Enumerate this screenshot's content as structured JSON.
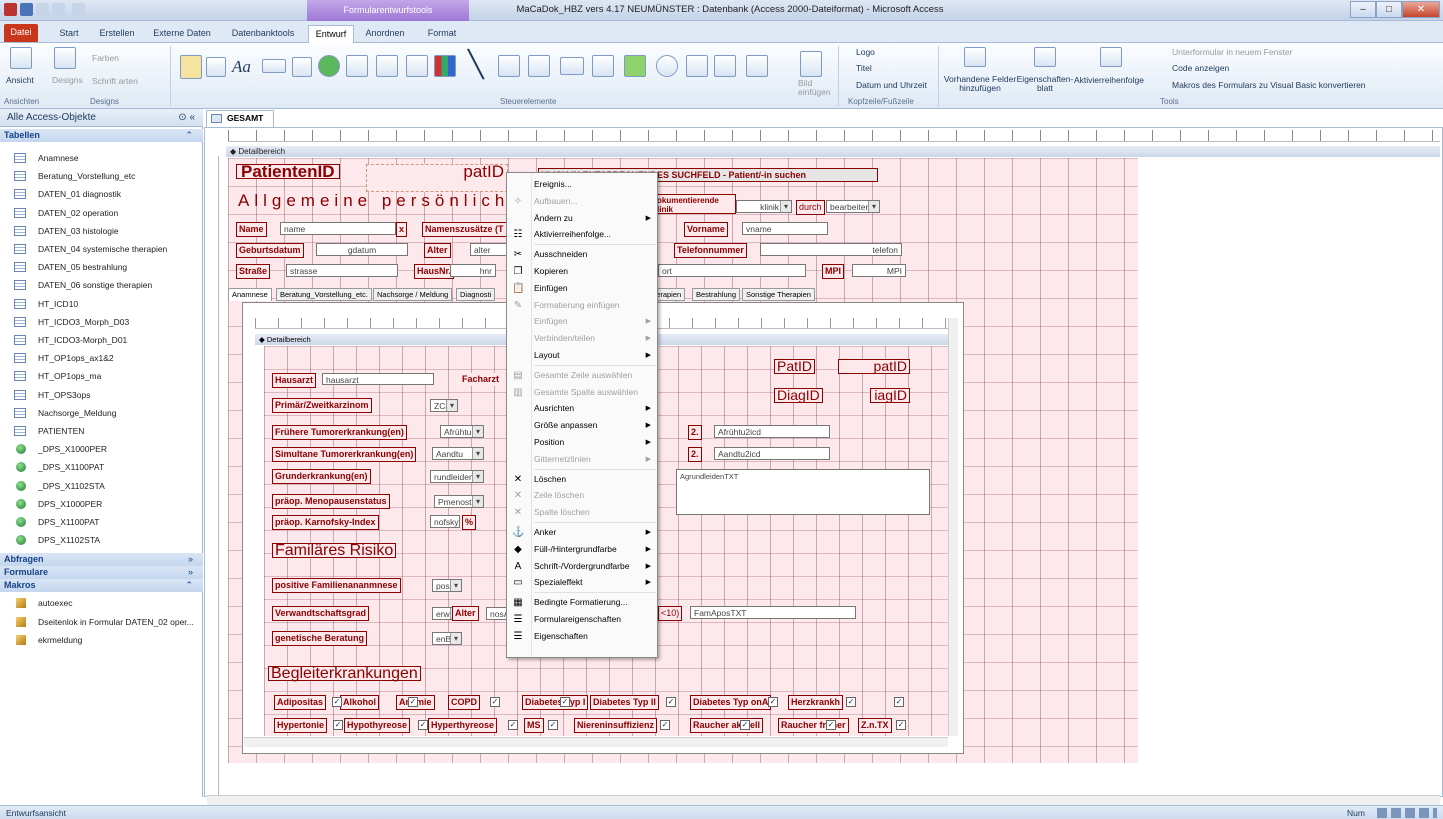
{
  "window": {
    "title": "MaCaDok_HBZ vers 4.17 NEUMÜNSTER : Datenbank (Access 2000-Dateiformat) - Microsoft Access",
    "context_tab": "Formularentwurfstools",
    "min": "–",
    "max": "□",
    "close": "✕"
  },
  "ribbon_tabs": [
    "Datei",
    "Start",
    "Erstellen",
    "Externe Daten",
    "Datenbanktools",
    "Entwurf",
    "Anordnen",
    "Format"
  ],
  "ribbon": {
    "ansicht": "Ansicht",
    "designs": "Designs",
    "farben": "Farben",
    "schriftarten": "Schrift arten",
    "bild": "Bild einfügen",
    "logo": "Logo",
    "titel": "Titel",
    "datum": "Datum und Uhrzeit",
    "vorhandene": "Vorhandene Felder hinzufügen",
    "eigenschaften": "Eigenschaften- blatt",
    "aktivierreihenfolge": "Aktivierreihenfolge",
    "unterformular": "Unterformular in neuem Fenster",
    "code": "Code anzeigen",
    "makros": "Makros des Formulars zu Visual Basic konvertieren",
    "groups": {
      "ansichten": "Ansichten",
      "designs": "Designs",
      "steuerelemente": "Steuerelemente",
      "kopfzeile": "Kopfzeile/Fußzeile",
      "tools": "Tools"
    }
  },
  "nav": {
    "header": "Alle Access-Objekte",
    "tabellen": "Tabellen",
    "tables": [
      "Anamnese",
      "Beratung_Vorstellung_etc",
      "DATEN_01 diagnostik",
      "DATEN_02 operation",
      "DATEN_03 histologie",
      "DATEN_04 systemische therapien",
      "DATEN_05 bestrahlung",
      "DATEN_06 sonstige therapien",
      "HT_ICD10",
      "HT_ICDO3_Morph_D03",
      "HT_ICDO3-Morph_D01",
      "HT_OP1ops_ax1&2",
      "HT_OP1ops_ma",
      "HT_OPS3ops",
      "Nachsorge_Meldung",
      "PATIENTEN"
    ],
    "linked": [
      "_DPS_X1000PER",
      "_DPS_X1100PAT",
      "_DPS_X1102STA",
      "DPS_X1000PER",
      "DPS_X1100PAT",
      "DPS_X1102STA"
    ],
    "abfragen": "Abfragen",
    "formulare": "Formulare",
    "makros": "Makros",
    "macros": [
      "autoexec",
      "Dseitenlok in Formular DATEN_02 oper...",
      "ekrmeldung"
    ]
  },
  "doc": {
    "tab": "GESAMT",
    "section": "Detailbereich",
    "patientenid": "PatientenID",
    "patid": "patID",
    "suchen": "KLICK IN ENTSPRECHENDES SUCHFELD  -  Patient/-in suchen",
    "allgemeine": "Allgemeine persönliche",
    "dokumentierende": "okumentierende linik",
    "klinik": "klinik",
    "durch": "durch",
    "bearbeiter": "bearbeiter",
    "name_lbl": "Name",
    "name_val": "name",
    "x": "x",
    "namenszusatz": "Namenszusätze (T",
    "vorname_lbl": "Vorname",
    "vorname_val": "vname",
    "geburtsdatum": "Geburtsdatum",
    "gdatum": "gdatum",
    "alter": "Alter",
    "alter_val": "alter",
    "telefonnummer": "Telefonnummer",
    "telefon": "telefon",
    "strasse": "Straße",
    "strasse_val": "strasse",
    "hausnr": "HausNr.",
    "hnr": "hnr",
    "ort": "ort",
    "mpi": "MPI",
    "mpi_val": "MPI",
    "subtabs": [
      "Anamnese",
      "Beratung_Vorstellung_etc.",
      "Nachsorge / Meldung",
      "Diagnosti",
      "herapien",
      "Bestrahlung",
      "Sonstige Therapien"
    ]
  },
  "sub": {
    "section": "Detailbereich",
    "hausarzt": "Hausarzt",
    "hausarzt_val": "hausarzt",
    "facharzt": "Facharzt",
    "patid_lbl": "PatID",
    "patid_val": "patID",
    "diagid_lbl": "DiagID",
    "diagid_val": "iagID",
    "primaer": "Primär/Zweitkarzinom",
    "zca": "ZCa",
    "fruehere": "Frühere Tumorerkrankung(en)",
    "afruehu": "Afrühtu",
    "two": "2.",
    "afruehu2": "Afrühtu2icd",
    "simultane": "Simultane Tumorerkrankung(en)",
    "aandtu": "Aandtu",
    "aandtu2": "Aandtu2icd",
    "grund": "Grunderkrankung(en)",
    "grund_val": "rundleiden",
    "grundtxt": "AgrundleidenTXT",
    "menopause": "präop. Menopausenstatus",
    "pmenost": "Pmenost",
    "karnofsky": "präop. Karnofsky-Index",
    "kval": "nofsky",
    "pct": "%",
    "familiaeres": "Familäres Risiko",
    "positive": "positive Familienananmnese",
    "pos": "pos",
    "verwandt": "Verwandtschaftsgrad",
    "verw_val": "erw",
    "alter2": "Alter",
    "alter2_val": "nosA",
    "lt10": "<10)",
    "famapos": "FamAposTXT",
    "genetische": "genetische Beratung",
    "gen_val": "enB",
    "begleiter": "Begleiterkrankungen",
    "row1": [
      "Adipositas",
      "Alkohol",
      "Anämie",
      "COPD",
      "Diabetes Typ I",
      "Diabetes Typ II",
      "Diabetes Typ onA",
      "Herzkrankh"
    ],
    "row2": [
      "Hypertonie",
      "Hypothyreose",
      "Hyperthyreose",
      "MS",
      "Niereninsuffizienz",
      "Raucher aktuell",
      "Raucher früher",
      "Z.n.TX"
    ]
  },
  "context_menu": [
    {
      "label": "Ereignis...",
      "icon": "",
      "disabled": false,
      "sub": false
    },
    {
      "label": "Aufbauen...",
      "icon": "wand-icon",
      "disabled": true,
      "sub": false
    },
    {
      "label": "Ändern zu",
      "icon": "",
      "disabled": false,
      "sub": true
    },
    {
      "label": "Aktivierreihenfolge...",
      "icon": "tab-order-icon",
      "disabled": false,
      "sub": false
    },
    {
      "label": "Ausschneiden",
      "icon": "scissors-icon",
      "disabled": false,
      "sub": false
    },
    {
      "label": "Kopieren",
      "icon": "copy-icon",
      "disabled": false,
      "sub": false
    },
    {
      "label": "Einfügen",
      "icon": "paste-icon",
      "disabled": false,
      "sub": false
    },
    {
      "label": "Formatierung einfügen",
      "icon": "format-paste-icon",
      "disabled": true,
      "sub": false
    },
    {
      "label": "Einfügen",
      "icon": "",
      "disabled": true,
      "sub": true
    },
    {
      "label": "Verbinden/teilen",
      "icon": "",
      "disabled": true,
      "sub": true
    },
    {
      "label": "Layout",
      "icon": "",
      "disabled": false,
      "sub": true
    },
    {
      "label": "Gesamte Zeile auswählen",
      "icon": "select-row-icon",
      "disabled": true,
      "sub": false
    },
    {
      "label": "Gesamte Spalte auswählen",
      "icon": "select-col-icon",
      "disabled": true,
      "sub": false
    },
    {
      "label": "Ausrichten",
      "icon": "",
      "disabled": false,
      "sub": true
    },
    {
      "label": "Größe anpassen",
      "icon": "",
      "disabled": false,
      "sub": true
    },
    {
      "label": "Position",
      "icon": "",
      "disabled": false,
      "sub": true
    },
    {
      "label": "Gitternetzlinien",
      "icon": "",
      "disabled": true,
      "sub": true
    },
    {
      "label": "Löschen",
      "icon": "delete-icon",
      "disabled": false,
      "sub": false
    },
    {
      "label": "Zeile löschen",
      "icon": "delete-row-icon",
      "disabled": true,
      "sub": false
    },
    {
      "label": "Spalte löschen",
      "icon": "delete-col-icon",
      "disabled": true,
      "sub": false
    },
    {
      "label": "Anker",
      "icon": "anchor-icon",
      "disabled": false,
      "sub": true
    },
    {
      "label": "Füll-/Hintergrundfarbe",
      "icon": "fill-color-icon",
      "disabled": false,
      "sub": true
    },
    {
      "label": "Schrift-/Vordergrundfarbe",
      "icon": "font-color-icon",
      "disabled": false,
      "sub": true
    },
    {
      "label": "Spezialeffekt",
      "icon": "special-effect-icon",
      "disabled": false,
      "sub": true
    },
    {
      "label": "Bedingte Formatierung...",
      "icon": "conditional-format-icon",
      "disabled": false,
      "sub": false
    },
    {
      "label": "Formulareigenschaften",
      "icon": "form-props-icon",
      "disabled": false,
      "sub": false
    },
    {
      "label": "Eigenschaften",
      "icon": "props-icon",
      "disabled": false,
      "sub": false
    }
  ],
  "status": {
    "left": "Entwurfsansicht",
    "right": "Num"
  },
  "colors": {
    "label": "#8b0000",
    "grid": "#fde8ec",
    "file_tab": "#c8361b"
  }
}
